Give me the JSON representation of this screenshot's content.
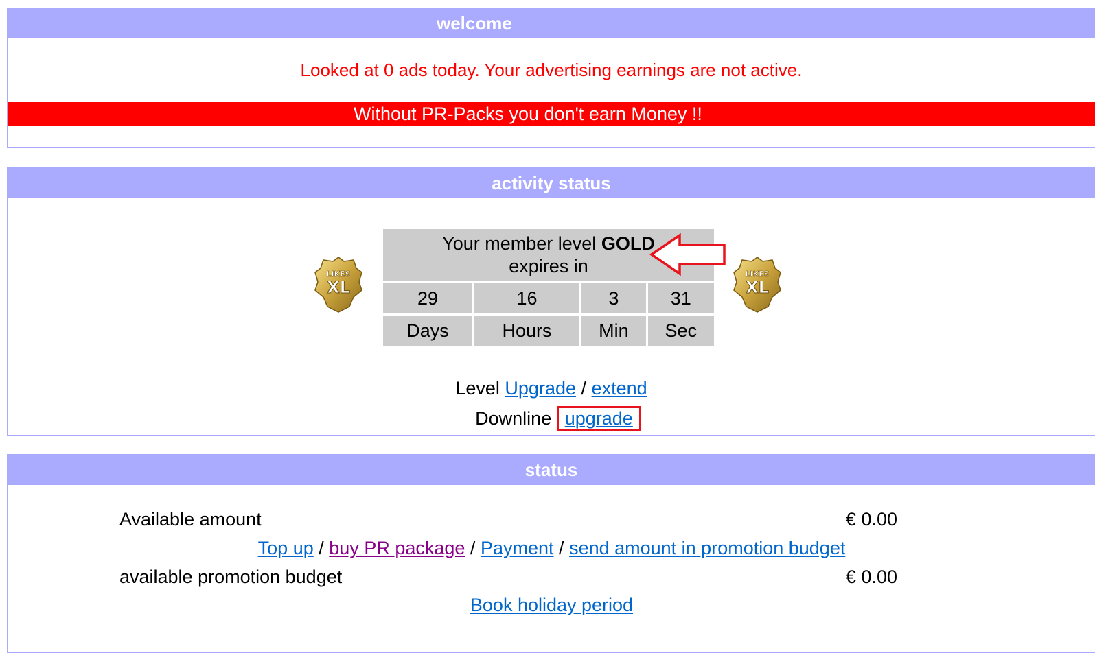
{
  "welcome": {
    "title": "welcome",
    "notice": "Looked at 0 ads today. Your advertising earnings are not active.",
    "warning": "Without PR-Packs you don't earn Money !!"
  },
  "activity": {
    "title": "activity status",
    "badge_text_top": "LIKES",
    "badge_text_main": "XL",
    "level_prefix": "Your member level",
    "level_name": "GOLD",
    "expires_label": "expires in",
    "countdown": {
      "days_value": "29",
      "hours_value": "16",
      "min_value": "3",
      "sec_value": "31",
      "days_label": "Days",
      "hours_label": "Hours",
      "min_label": "Min",
      "sec_label": "Sec"
    },
    "level_label": "Level",
    "upgrade_link": "Upgrade",
    "separator": "/",
    "extend_link": "extend",
    "downline_label": "Downline",
    "downline_upgrade_link": "upgrade"
  },
  "status": {
    "title": "status",
    "available_amount_label": "Available amount",
    "available_amount_value": "€ 0.00",
    "top_up_link": "Top up",
    "buy_pr_link": "buy PR package",
    "payment_link": "Payment",
    "send_budget_link": "send amount in promotion budget",
    "promotion_budget_label": "available promotion budget",
    "promotion_budget_value": "€ 0.00",
    "holiday_link": "Book holiday period"
  },
  "colors": {
    "header_bg": "#aaaaff",
    "warning_red": "#ff0000",
    "link_blue": "#0066cc",
    "visited_purple": "#880088",
    "highlight_red": "#e8141d",
    "timer_gray": "#cccccc"
  }
}
